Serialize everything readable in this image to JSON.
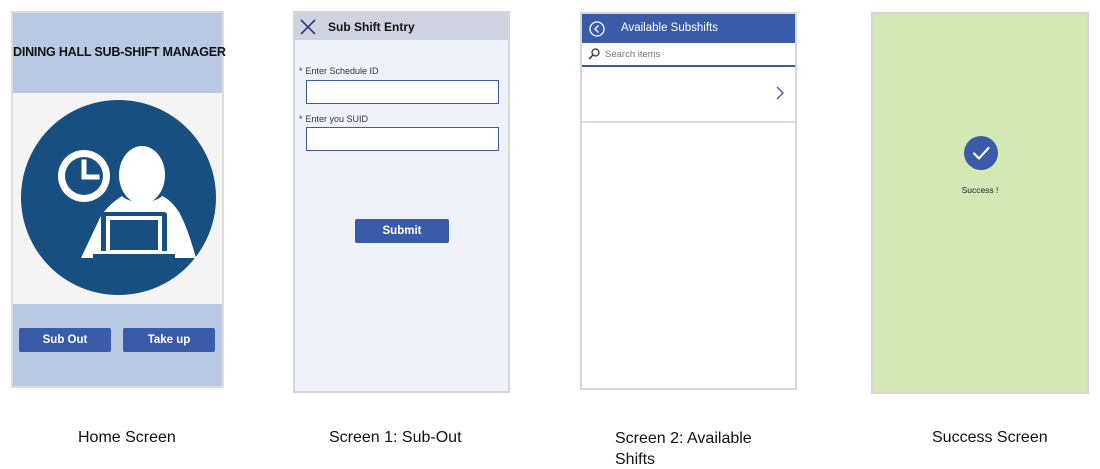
{
  "home": {
    "title": "DINING HALL SUB-SHIFT MANAGER",
    "sub_out_label": "Sub Out",
    "take_up_label": "Take up",
    "caption": "Home Screen"
  },
  "screen1": {
    "title": "Sub Shift Entry",
    "schedule_label": "Enter Schedule ID",
    "suid_label": "Enter you SUID",
    "required_marker": "*",
    "schedule_value": "",
    "suid_value": "",
    "submit_label": "Submit",
    "caption": "Screen 1: Sub-Out"
  },
  "screen2": {
    "title": "Available Subshifts",
    "search_placeholder": "Search items",
    "caption_line1": "Screen 2: Available",
    "caption_line2": "Shifts"
  },
  "success": {
    "message": "Success !",
    "caption": "Success Screen"
  },
  "colors": {
    "primary": "#3a5ba8",
    "home_header": "#b9c9e4",
    "home_circle": "#174f80",
    "success_bg": "#d3e8b3"
  },
  "icons": [
    "clock-icon",
    "person-laptop-icon",
    "close-icon",
    "back-arrow-icon",
    "search-icon",
    "chevron-right-icon",
    "checkmark-icon"
  ]
}
